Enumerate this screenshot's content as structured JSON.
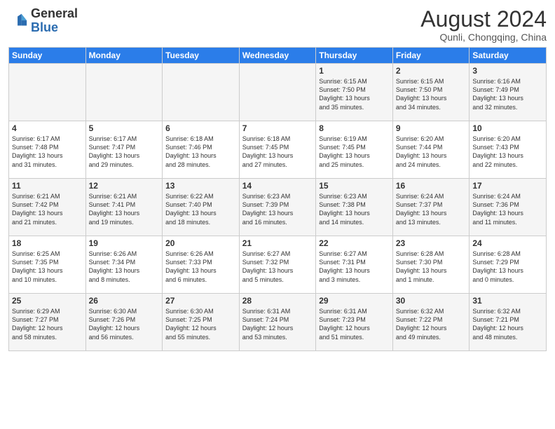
{
  "header": {
    "logo_general": "General",
    "logo_blue": "Blue",
    "month_title": "August 2024",
    "location": "Qunli, Chongqing, China"
  },
  "weekdays": [
    "Sunday",
    "Monday",
    "Tuesday",
    "Wednesday",
    "Thursday",
    "Friday",
    "Saturday"
  ],
  "weeks": [
    [
      {
        "day": "",
        "info": ""
      },
      {
        "day": "",
        "info": ""
      },
      {
        "day": "",
        "info": ""
      },
      {
        "day": "",
        "info": ""
      },
      {
        "day": "1",
        "info": "Sunrise: 6:15 AM\nSunset: 7:50 PM\nDaylight: 13 hours\nand 35 minutes."
      },
      {
        "day": "2",
        "info": "Sunrise: 6:15 AM\nSunset: 7:50 PM\nDaylight: 13 hours\nand 34 minutes."
      },
      {
        "day": "3",
        "info": "Sunrise: 6:16 AM\nSunset: 7:49 PM\nDaylight: 13 hours\nand 32 minutes."
      }
    ],
    [
      {
        "day": "4",
        "info": "Sunrise: 6:17 AM\nSunset: 7:48 PM\nDaylight: 13 hours\nand 31 minutes."
      },
      {
        "day": "5",
        "info": "Sunrise: 6:17 AM\nSunset: 7:47 PM\nDaylight: 13 hours\nand 29 minutes."
      },
      {
        "day": "6",
        "info": "Sunrise: 6:18 AM\nSunset: 7:46 PM\nDaylight: 13 hours\nand 28 minutes."
      },
      {
        "day": "7",
        "info": "Sunrise: 6:18 AM\nSunset: 7:45 PM\nDaylight: 13 hours\nand 27 minutes."
      },
      {
        "day": "8",
        "info": "Sunrise: 6:19 AM\nSunset: 7:45 PM\nDaylight: 13 hours\nand 25 minutes."
      },
      {
        "day": "9",
        "info": "Sunrise: 6:20 AM\nSunset: 7:44 PM\nDaylight: 13 hours\nand 24 minutes."
      },
      {
        "day": "10",
        "info": "Sunrise: 6:20 AM\nSunset: 7:43 PM\nDaylight: 13 hours\nand 22 minutes."
      }
    ],
    [
      {
        "day": "11",
        "info": "Sunrise: 6:21 AM\nSunset: 7:42 PM\nDaylight: 13 hours\nand 21 minutes."
      },
      {
        "day": "12",
        "info": "Sunrise: 6:21 AM\nSunset: 7:41 PM\nDaylight: 13 hours\nand 19 minutes."
      },
      {
        "day": "13",
        "info": "Sunrise: 6:22 AM\nSunset: 7:40 PM\nDaylight: 13 hours\nand 18 minutes."
      },
      {
        "day": "14",
        "info": "Sunrise: 6:23 AM\nSunset: 7:39 PM\nDaylight: 13 hours\nand 16 minutes."
      },
      {
        "day": "15",
        "info": "Sunrise: 6:23 AM\nSunset: 7:38 PM\nDaylight: 13 hours\nand 14 minutes."
      },
      {
        "day": "16",
        "info": "Sunrise: 6:24 AM\nSunset: 7:37 PM\nDaylight: 13 hours\nand 13 minutes."
      },
      {
        "day": "17",
        "info": "Sunrise: 6:24 AM\nSunset: 7:36 PM\nDaylight: 13 hours\nand 11 minutes."
      }
    ],
    [
      {
        "day": "18",
        "info": "Sunrise: 6:25 AM\nSunset: 7:35 PM\nDaylight: 13 hours\nand 10 minutes."
      },
      {
        "day": "19",
        "info": "Sunrise: 6:26 AM\nSunset: 7:34 PM\nDaylight: 13 hours\nand 8 minutes."
      },
      {
        "day": "20",
        "info": "Sunrise: 6:26 AM\nSunset: 7:33 PM\nDaylight: 13 hours\nand 6 minutes."
      },
      {
        "day": "21",
        "info": "Sunrise: 6:27 AM\nSunset: 7:32 PM\nDaylight: 13 hours\nand 5 minutes."
      },
      {
        "day": "22",
        "info": "Sunrise: 6:27 AM\nSunset: 7:31 PM\nDaylight: 13 hours\nand 3 minutes."
      },
      {
        "day": "23",
        "info": "Sunrise: 6:28 AM\nSunset: 7:30 PM\nDaylight: 13 hours\nand 1 minute."
      },
      {
        "day": "24",
        "info": "Sunrise: 6:28 AM\nSunset: 7:29 PM\nDaylight: 13 hours\nand 0 minutes."
      }
    ],
    [
      {
        "day": "25",
        "info": "Sunrise: 6:29 AM\nSunset: 7:27 PM\nDaylight: 12 hours\nand 58 minutes."
      },
      {
        "day": "26",
        "info": "Sunrise: 6:30 AM\nSunset: 7:26 PM\nDaylight: 12 hours\nand 56 minutes."
      },
      {
        "day": "27",
        "info": "Sunrise: 6:30 AM\nSunset: 7:25 PM\nDaylight: 12 hours\nand 55 minutes."
      },
      {
        "day": "28",
        "info": "Sunrise: 6:31 AM\nSunset: 7:24 PM\nDaylight: 12 hours\nand 53 minutes."
      },
      {
        "day": "29",
        "info": "Sunrise: 6:31 AM\nSunset: 7:23 PM\nDaylight: 12 hours\nand 51 minutes."
      },
      {
        "day": "30",
        "info": "Sunrise: 6:32 AM\nSunset: 7:22 PM\nDaylight: 12 hours\nand 49 minutes."
      },
      {
        "day": "31",
        "info": "Sunrise: 6:32 AM\nSunset: 7:21 PM\nDaylight: 12 hours\nand 48 minutes."
      }
    ]
  ]
}
